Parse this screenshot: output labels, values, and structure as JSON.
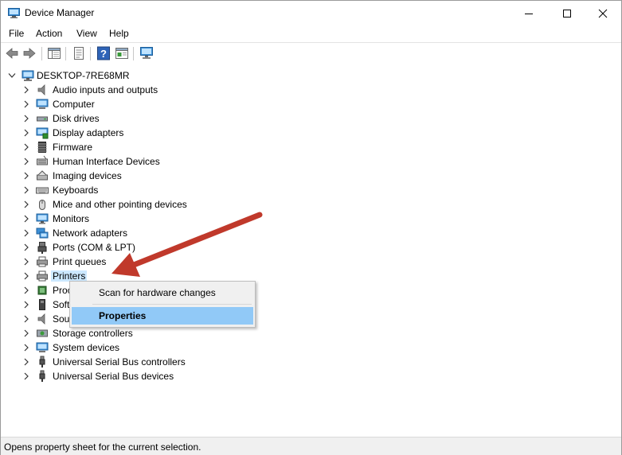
{
  "window": {
    "title": "Device Manager",
    "controls": [
      "minimize",
      "maximize",
      "close"
    ]
  },
  "menubar": {
    "file": "File",
    "action": "Action",
    "view": "View",
    "help": "Help"
  },
  "toolbar": {
    "icons": [
      "back-icon",
      "forward-icon",
      "show-hide-console-tree-icon",
      "properties-icon",
      "help-icon",
      "update-driver-icon",
      "scan-hardware-icon"
    ]
  },
  "tree": {
    "root": "DESKTOP-7RE68MR",
    "items": [
      {
        "label": "Audio inputs and outputs",
        "icon": "speaker-icon"
      },
      {
        "label": "Computer",
        "icon": "computer-icon"
      },
      {
        "label": "Disk drives",
        "icon": "disk-drive-icon"
      },
      {
        "label": "Display adapters",
        "icon": "display-adapter-icon"
      },
      {
        "label": "Firmware",
        "icon": "firmware-icon"
      },
      {
        "label": "Human Interface Devices",
        "icon": "hid-icon"
      },
      {
        "label": "Imaging devices",
        "icon": "imaging-device-icon"
      },
      {
        "label": "Keyboards",
        "icon": "keyboard-icon"
      },
      {
        "label": "Mice and other pointing devices",
        "icon": "mouse-icon"
      },
      {
        "label": "Monitors",
        "icon": "monitor-icon"
      },
      {
        "label": "Network adapters",
        "icon": "network-adapter-icon"
      },
      {
        "label": "Ports (COM & LPT)",
        "icon": "port-icon"
      },
      {
        "label": "Print queues",
        "icon": "print-queue-icon"
      },
      {
        "label": "Printers",
        "icon": "printer-icon"
      },
      {
        "label": "Proc",
        "icon": "processor-icon"
      },
      {
        "label": "Soft",
        "icon": "software-device-icon"
      },
      {
        "label": "Sour",
        "icon": "sound-icon"
      },
      {
        "label": "Storage controllers",
        "icon": "storage-controller-icon"
      },
      {
        "label": "System devices",
        "icon": "system-device-icon"
      },
      {
        "label": "Universal Serial Bus controllers",
        "icon": "usb-icon"
      },
      {
        "label": "Universal Serial Bus devices",
        "icon": "usb-icon"
      }
    ],
    "selected": "Printers"
  },
  "context_menu": {
    "items": [
      {
        "label": "Scan for hardware changes"
      },
      {
        "label": "Properties",
        "highlighted": true
      }
    ]
  },
  "status_bar": {
    "text": "Opens property sheet for the current selection."
  },
  "colors": {
    "selection": "#cce8ff",
    "menu_highlight": "#91c9f7",
    "annotation_arrow": "#c0392b"
  }
}
